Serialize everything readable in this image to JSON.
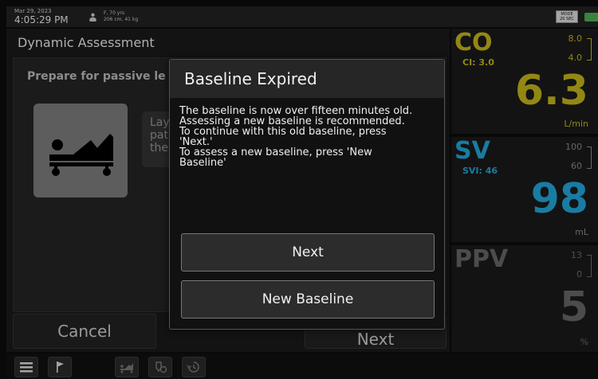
{
  "status_bar": {
    "date": "Mar 29, 2023",
    "time": "4:05:29 PM",
    "patient_line1": "F, 70 yrs",
    "patient_line2": "206 cm, 41 kg",
    "mode_line1": "MODE",
    "mode_line2": "20 SEC",
    "patient_icon": "person-icon",
    "battery_icon": "battery-icon"
  },
  "panel": {
    "title": "Dynamic Assessment",
    "prepare_text": "Prepare for passive le",
    "bed_icon": "hospital-bed-icon",
    "info_line1": "Lay",
    "info_line2": "pat",
    "info_line3": "the",
    "cancel_label": "Cancel",
    "next_label": "Next"
  },
  "parameters": {
    "co": {
      "name": "CO",
      "sub": "CI: 3.0",
      "high": "8.0",
      "low": "4.0",
      "value": "6.3",
      "unit": "L/min",
      "color": "#c5b41b"
    },
    "sv": {
      "name": "SV",
      "sub": "SVI: 46",
      "high": "100",
      "low": "60",
      "value": "98",
      "unit": "mL",
      "color": "#22a6d8"
    },
    "ppv": {
      "name": "PPV",
      "high": "13",
      "low": "0",
      "value": "5",
      "unit": "%",
      "color": "#666666"
    }
  },
  "toolbar": {
    "icons": [
      "menu-icon",
      "flag-icon",
      "passive-leg-raise-icon",
      "fluid-challenge-icon",
      "history-icon"
    ]
  },
  "modal": {
    "title": "Baseline Expired",
    "body_lines": [
      "The baseline is now over fifteen minutes old.",
      "Assessing a new baseline is recommended.",
      "To continue with this old baseline, press",
      "'Next.'",
      "To assess a new baseline, press 'New",
      "Baseline'"
    ],
    "next_label": "Next",
    "new_baseline_label": "New Baseline"
  }
}
